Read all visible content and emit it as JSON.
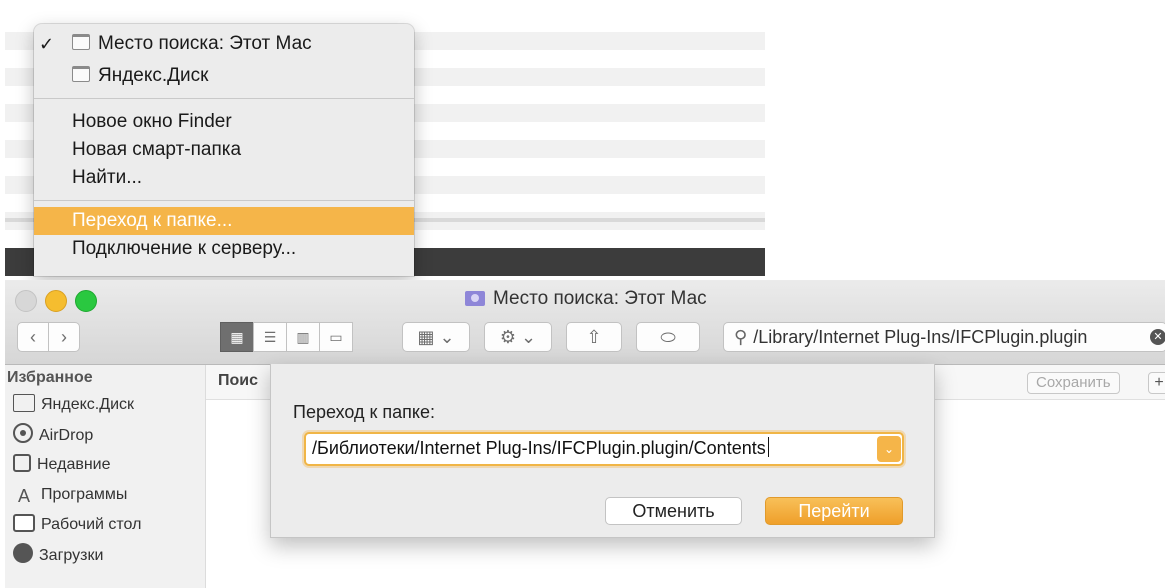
{
  "menu": {
    "items": [
      {
        "label": "Место поиска: Этот Мас",
        "checked": true,
        "icon": "window-icon"
      },
      {
        "label": "Яндекс.Диск",
        "icon": "window-icon"
      },
      {
        "label": "Новое окно Finder"
      },
      {
        "label": "Новая смарт-папка"
      },
      {
        "label": "Найти..."
      },
      {
        "label": "Переход к папке...",
        "highlighted": true
      },
      {
        "label": "Подключение к серверу..."
      }
    ],
    "check_mark": "✓"
  },
  "window": {
    "title": "Место поиска: Этот Мас",
    "search_value": "/Library/Internet Plug-Ins/IFCPlugin.plugin"
  },
  "sidebar": {
    "header": "Избранное",
    "items": [
      {
        "label": "Яндекс.Диск",
        "icon": "folder-icon"
      },
      {
        "label": "AirDrop",
        "icon": "airdrop-icon"
      },
      {
        "label": "Недавние",
        "icon": "recents-icon"
      },
      {
        "label": "Программы",
        "icon": "applications-icon"
      },
      {
        "label": "Рабочий стол",
        "icon": "desktop-icon"
      },
      {
        "label": "Загрузки",
        "icon": "downloads-icon"
      }
    ]
  },
  "main": {
    "header_label": "Поис",
    "save_label": "Сохранить",
    "plus_label": "+"
  },
  "sheet": {
    "label": "Переход к папке:",
    "path_value": "/Библиотеки/Internet Plug-Ins/IFCPlugin.plugin/Contents",
    "cancel_label": "Отменить",
    "go_label": "Перейти"
  },
  "colors": {
    "accent": "#f5b549",
    "close": "#d7d7d7",
    "minimize": "#f5bd2f",
    "maximize": "#2ac840"
  }
}
